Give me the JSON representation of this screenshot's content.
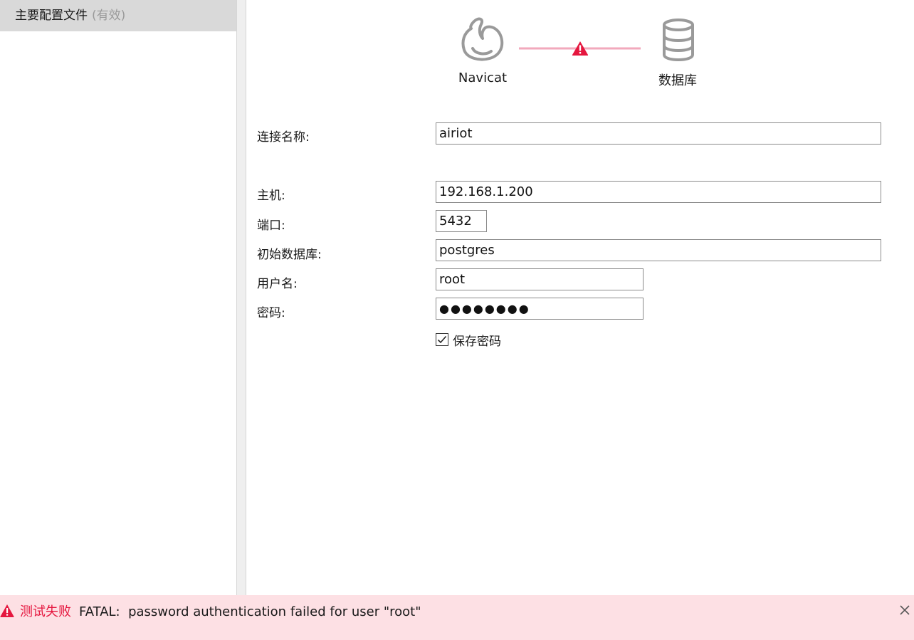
{
  "sidebar": {
    "items": [
      {
        "label": "主要配置文件",
        "status": "(有效)"
      }
    ]
  },
  "diagram": {
    "left_label": "Navicat",
    "right_label": "数据库",
    "left_icon": "navicat-logo-icon",
    "right_icon": "database-icon",
    "link_status_icon": "warning-icon",
    "colors": {
      "link": "#f2a9bc",
      "warning": "#e5173f",
      "icon": "#9a9a9a"
    }
  },
  "form": {
    "connection_name": {
      "label": "连接名称:",
      "value": "airiot"
    },
    "host": {
      "label": "主机:",
      "value": "192.168.1.200"
    },
    "port": {
      "label": "端口:",
      "value": "5432"
    },
    "initial_db": {
      "label": "初始数据库:",
      "value": "postgres"
    },
    "username": {
      "label": "用户名:",
      "value": "root"
    },
    "password": {
      "label": "密码:",
      "value": "●●●●●●●●"
    },
    "save_password": {
      "label": "保存密码",
      "checked": true
    }
  },
  "status_bar": {
    "title": "测试失败",
    "message": "FATAL:  password authentication failed for user \"root\"",
    "colors": {
      "background": "#fde0e4",
      "title": "#e5173f"
    }
  }
}
